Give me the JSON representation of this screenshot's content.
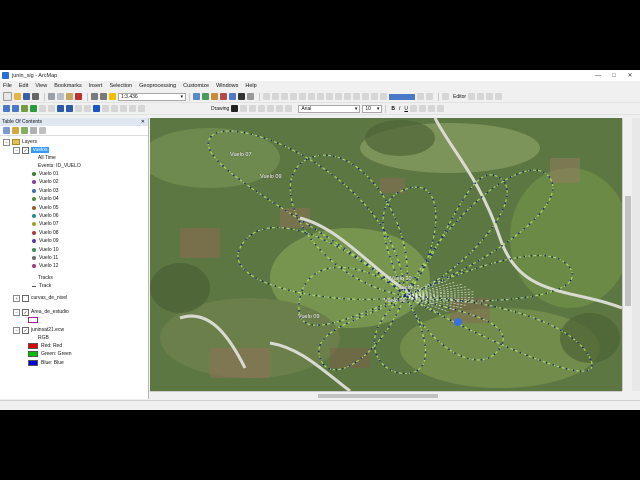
{
  "window": {
    "title": "junin_sig - ArcMap",
    "controls": [
      "—",
      "□",
      "✕"
    ]
  },
  "menu": [
    "File",
    "Edit",
    "View",
    "Bookmarks",
    "Insert",
    "Selection",
    "Geoprocessing",
    "Customize",
    "Windows",
    "Help"
  ],
  "toolbar": {
    "scale": "1:3.436",
    "drawing_label": "Drawing",
    "font_name": "Arial",
    "font_size": "10",
    "editor_label": "Editor"
  },
  "toc": {
    "title": "Table Of Contents",
    "close": "✕",
    "root": "Layers",
    "vuelos_layer": "vuelos",
    "time_label": "All Time",
    "events_label": "Events: ID_VUELO",
    "flights": [
      {
        "name": "Vuelo 01",
        "color": "#3b7d2e"
      },
      {
        "name": "Vuelo 02",
        "color": "#8a3a9a"
      },
      {
        "name": "Vuelo 03",
        "color": "#3a6fb0"
      },
      {
        "name": "Vuelo 04",
        "color": "#4f8f3a"
      },
      {
        "name": "Vuelo 05",
        "color": "#9a5a2a"
      },
      {
        "name": "Vuelo 06",
        "color": "#2a8a8a"
      },
      {
        "name": "Vuelo 07",
        "color": "#a0a020"
      },
      {
        "name": "Vuelo 08",
        "color": "#b03a3a"
      },
      {
        "name": "Vuelo 09",
        "color": "#5a3ab0"
      },
      {
        "name": "Vuelo 10",
        "color": "#3a8a5a"
      },
      {
        "name": "Vuelo 11",
        "color": "#6a6a6a"
      },
      {
        "name": "Vuelo 12",
        "color": "#a03a7a"
      }
    ],
    "tracks_label": "Tracks",
    "track_label": "Track",
    "curvas_layer": "curvas_de_nivel",
    "area_layer": "Area_de_estudio",
    "raster_layer": "juninsat21.ecw",
    "rgb_label": "RGB",
    "bands": [
      {
        "label": "Red:   Red",
        "color": "#e00000"
      },
      {
        "label": "Green: Green",
        "color": "#00c000"
      },
      {
        "label": "Blue:  Blue",
        "color": "#0000e0"
      }
    ],
    "area_swatch_color": "#a020a0"
  },
  "map": {
    "labels": [
      "Vuelo 07",
      "Vuelo 09",
      "Vuelo 10",
      "Vuelo 12",
      "Vuelo 06",
      "Vuelo 09"
    ],
    "track_color": "#b6e65a",
    "dot_color": "#1c2a8a"
  }
}
